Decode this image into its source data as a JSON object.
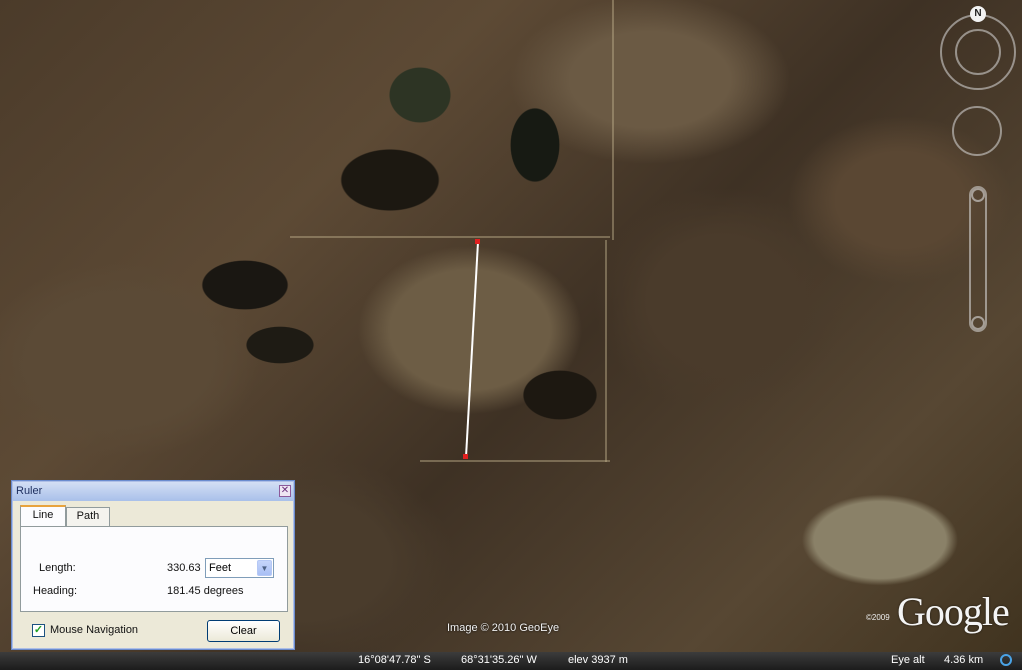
{
  "map": {
    "imagery_credit": "Image © 2010 GeoEye",
    "copyright_year": "©2009",
    "logo_text": "Google",
    "compass_north": "N"
  },
  "status_bar": {
    "latitude": "16°08'47.78\" S",
    "longitude": "68°31'35.26\" W",
    "elevation": "elev  3937 m",
    "eye_alt_label": "Eye alt",
    "eye_alt_value": "4.36 km"
  },
  "ruler_dialog": {
    "title": "Ruler",
    "close_glyph": "✕",
    "tabs": [
      {
        "label": "Line",
        "active": true
      },
      {
        "label": "Path",
        "active": false
      }
    ],
    "length_label": "Length:",
    "length_value": "330.63",
    "unit_selected": "Feet",
    "heading_label": "Heading:",
    "heading_value": "181.45 degrees",
    "mouse_navigation_label": "Mouse Navigation",
    "mouse_navigation_checked": true,
    "clear_button": "Clear"
  }
}
